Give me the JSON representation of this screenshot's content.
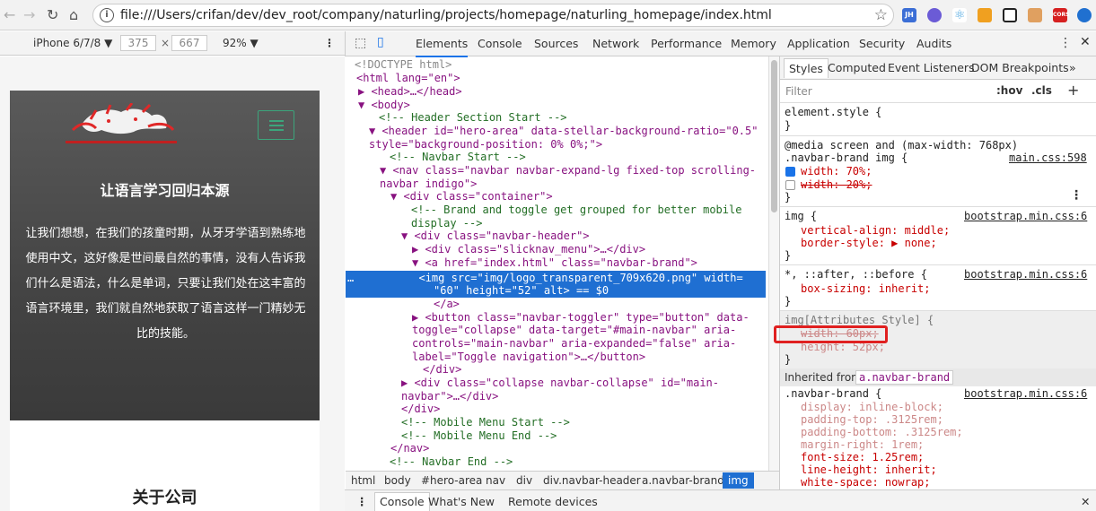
{
  "browser": {
    "url": "file:///Users/crifan/dev/dev_root/company/naturling/projects/homepage/naturling_homepage/index.html",
    "ext_labels": [
      "JH",
      "CORS"
    ]
  },
  "device": {
    "name": "iPhone 6/7/8",
    "width": "375",
    "height": "667",
    "zoom": "92%"
  },
  "page": {
    "hero_title": "让语言学习回归本源",
    "hero_text": "让我们想想，在我们的孩童时期，从牙牙学语到熟练地使用中文，这好像是世间最自然的事情，没有人告诉我们什么是语法，什么是单词，只要让我们处在这丰富的语言环境里，我们就自然地获取了语言这样一门精妙无比的技能。",
    "about_title": "关于公司"
  },
  "devtools": {
    "tabs": [
      "Elements",
      "Console",
      "Sources",
      "Network",
      "Performance",
      "Memory",
      "Application",
      "Security",
      "Audits"
    ],
    "active_tab": "Elements",
    "crumbs": [
      "html",
      "body",
      "#hero-area",
      "nav",
      "div",
      "div.navbar-header",
      "a.navbar-brand",
      "img"
    ],
    "drawer_tabs": [
      "Console",
      "What's New",
      "Remote devices"
    ],
    "style_tabs": [
      "Styles",
      "Computed",
      "Event Listeners",
      "DOM Breakpoints"
    ],
    "filter": {
      "placeholder": "Filter",
      "hov": ":hov",
      "cls": ".cls"
    },
    "inherited_label": "Inherited from",
    "inherited_from": "a.navbar-brand"
  },
  "dom_lines": [
    "<!DOCTYPE html>",
    "<html lang=\"en\">",
    "<head>…</head>",
    "<body>",
    "<!-- Header Section Start -->",
    "<header id=\"hero-area\" data-stellar-background-ratio=\"0.5\"",
    "style=\"background-position: 0% 0%;\">",
    "<!-- Navbar Start -->",
    "<nav class=\"navbar navbar-expand-lg fixed-top scrolling-",
    "navbar indigo\">",
    "<div class=\"container\">",
    "<!-- Brand and toggle get grouped for better mobile",
    "display -->",
    "<div class=\"navbar-header\">",
    "<div class=\"slicknav_menu\">…</div>",
    "<a href=\"index.html\" class=\"navbar-brand\">",
    "<img src=\"img/logo_transparent_709x620.png\" width=",
    "\"60\" height=\"52\" alt> == $0",
    "</a>",
    "<button class=\"navbar-toggler\" type=\"button\" data-",
    "toggle=\"collapse\" data-target=\"#main-navbar\" aria-",
    "controls=\"main-navbar\" aria-expanded=\"false\" aria-",
    "label=\"Toggle navigation\">…</button>",
    "</div>",
    "<div class=\"collapse navbar-collapse\" id=\"main-",
    "navbar\">…</div>",
    "</div>",
    "<!-- Mobile Menu Start -->",
    "<!-- Mobile Menu End -->",
    "</nav>",
    "<!-- Navbar End -->"
  ],
  "style_lines": [
    "element.style {",
    "}",
    "@media screen and (max-width: 768px)",
    ".navbar-brand img {",
    "main.css:598",
    "width: 70%;",
    "width: 20%;",
    "}",
    "img {",
    "bootstrap.min.css:6",
    "vertical-align: middle;",
    "border-style: ▶ none;",
    "}",
    "*, ::after, ::before {",
    "bootstrap.min.css:6",
    "box-sizing: inherit;",
    "}",
    "img[Attributes Style] {",
    "width: 60px;",
    "height: 52px;",
    "}",
    ".navbar-brand {",
    "bootstrap.min.css:6",
    "display: inline-block;",
    "padding-top: .3125rem;",
    "padding-bottom: .3125rem;",
    "margin-right: 1rem;",
    "font-size: 1.25rem;",
    "line-height: inherit;",
    "white-space: nowrap;"
  ],
  "colors": {
    "accent": "#1a73e8",
    "selection": "#1f6fd2",
    "toggler": "#3ca57c",
    "highlight_box": "#e02020"
  }
}
